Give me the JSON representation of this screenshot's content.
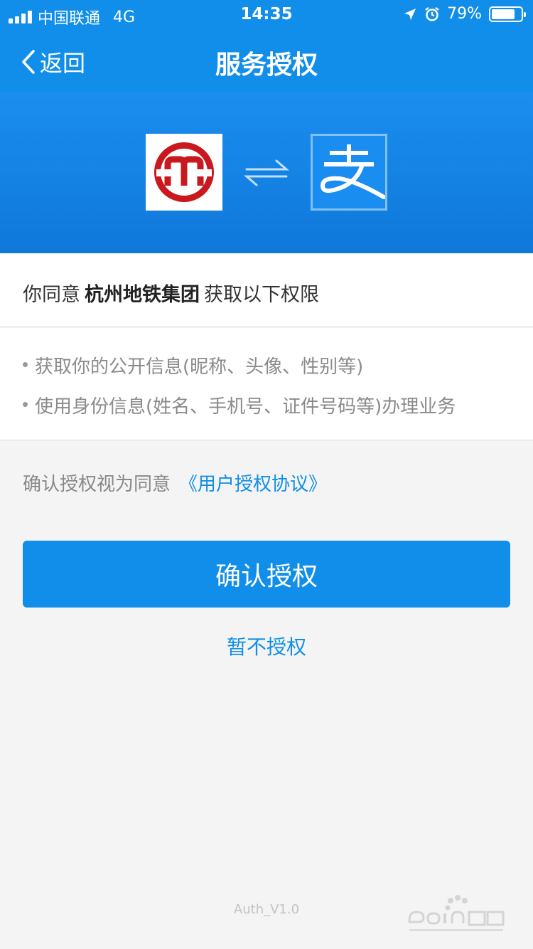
{
  "status_bar": {
    "carrier": "中国联通",
    "network": "4G",
    "time": "14:35",
    "battery_text": "79%",
    "battery_level": 0.79
  },
  "nav": {
    "back_label": "返回",
    "title": "服务授权"
  },
  "banner": {
    "left_logo": "metro-logo",
    "right_logo": "alipay-logo",
    "alipay_glyph": "支",
    "swap_icon": "swap-arrows-icon"
  },
  "consent": {
    "prefix": "你同意",
    "org": "杭州地铁集团",
    "suffix": "获取以下权限"
  },
  "permissions": [
    "获取你的公开信息(昵称、头像、性别等)",
    "使用身份信息(姓名、手机号、证件号码等)办理业务"
  ],
  "agreement": {
    "text": "确认授权视为同意",
    "link": "《用户授权协议》"
  },
  "actions": {
    "confirm": "确认授权",
    "decline": "暂不授权"
  },
  "footer": {
    "version": "Auth_V1.0"
  },
  "colors": {
    "primary": "#108ee9",
    "metro_red": "#c9181e"
  }
}
